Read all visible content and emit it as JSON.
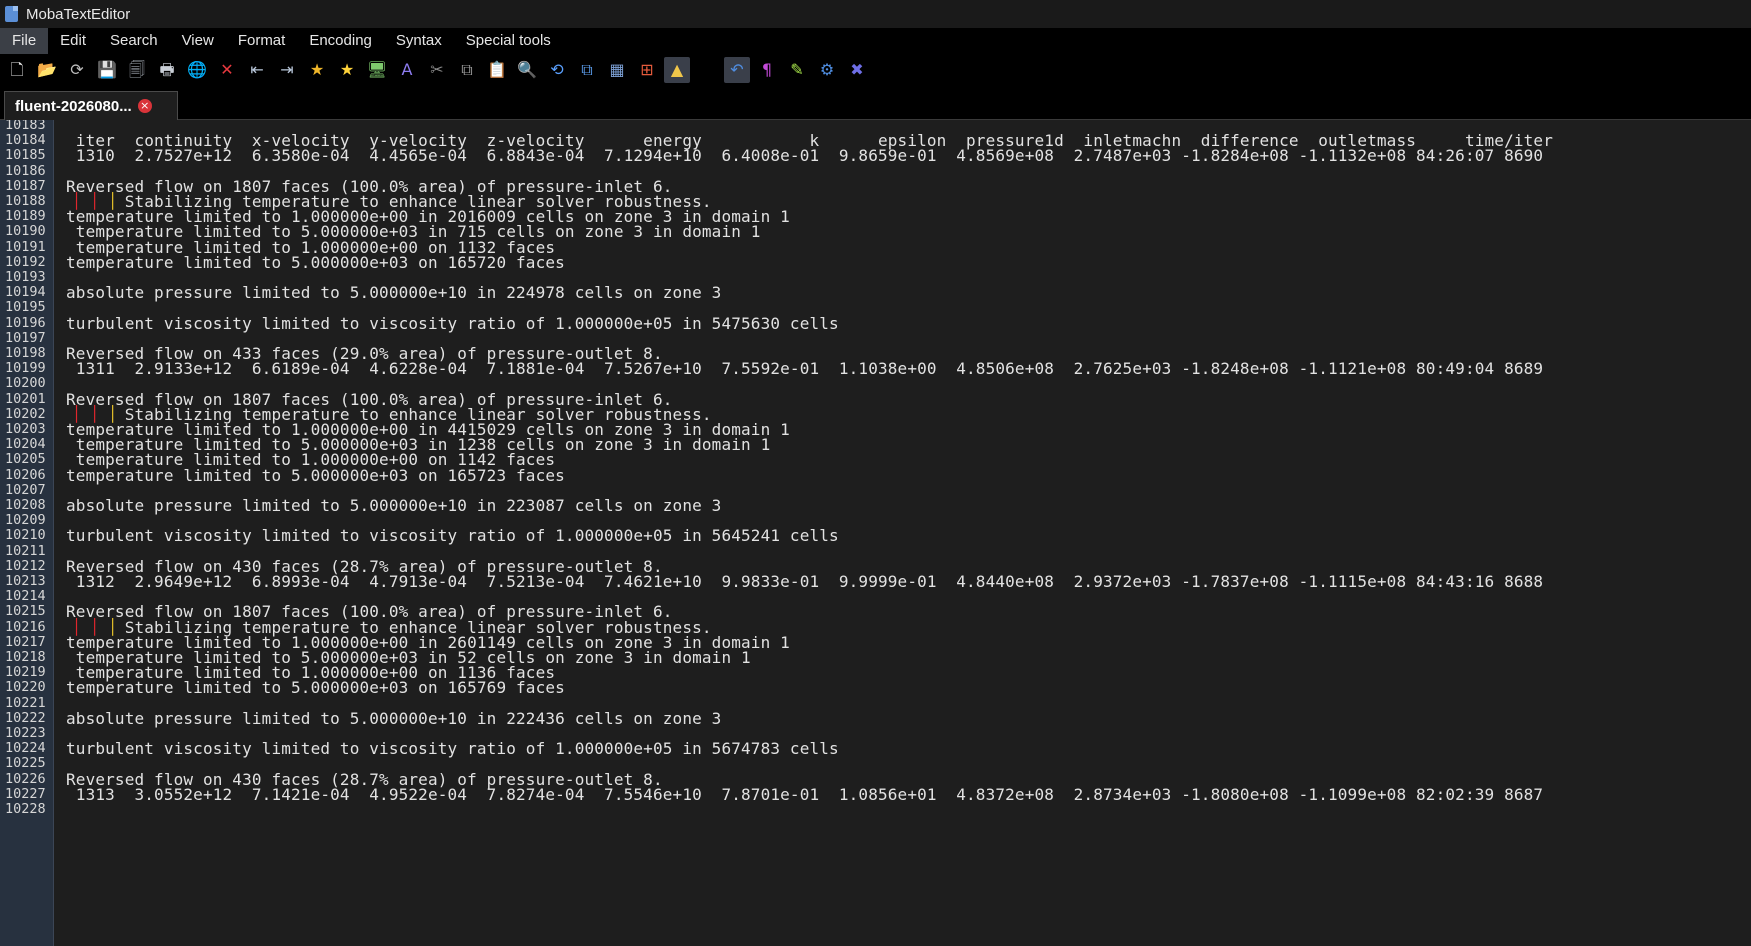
{
  "window": {
    "title": "MobaTextEditor"
  },
  "menu": [
    {
      "label": "File",
      "active": true
    },
    {
      "label": "Edit"
    },
    {
      "label": "Search"
    },
    {
      "label": "View"
    },
    {
      "label": "Format"
    },
    {
      "label": "Encoding"
    },
    {
      "label": "Syntax"
    },
    {
      "label": "Special tools"
    }
  ],
  "toolbar": [
    {
      "name": "new-file-icon",
      "glyph": "🗋",
      "color": "#e8e8e8"
    },
    {
      "name": "open-folder-icon",
      "glyph": "📂",
      "color": "#f1b93d"
    },
    {
      "name": "reload-icon",
      "glyph": "⟳",
      "color": "#bdbdbd"
    },
    {
      "name": "save-icon",
      "glyph": "💾",
      "color": "#9da3ab"
    },
    {
      "name": "save-all-icon",
      "glyph": "🗐",
      "color": "#9da3ab"
    },
    {
      "name": "print-icon",
      "glyph": "🖶",
      "color": "#c9ced6"
    },
    {
      "name": "globe-icon",
      "glyph": "🌐",
      "color": "#4aa3e8"
    },
    {
      "name": "close-icon",
      "glyph": "✕",
      "color": "#e6393f"
    },
    {
      "name": "outdent-icon",
      "glyph": "⇤",
      "color": "#b9c7da"
    },
    {
      "name": "indent-icon",
      "glyph": "⇥",
      "color": "#b9c7da"
    },
    {
      "name": "bookmark-star-icon",
      "glyph": "★",
      "color": "#f0b72a"
    },
    {
      "name": "bookmark-star-2-icon",
      "glyph": "★",
      "color": "#ffd33a"
    },
    {
      "name": "terminal-icon",
      "glyph": "🖥",
      "color": "#7ec86d"
    },
    {
      "name": "font-icon",
      "glyph": "A",
      "color": "#8d7cf0"
    },
    {
      "name": "cut-icon",
      "glyph": "✂",
      "color": "#8a8a8a"
    },
    {
      "name": "copy-icon",
      "glyph": "⧉",
      "color": "#9a9a9a"
    },
    {
      "name": "paste-icon",
      "glyph": "📋",
      "color": "#d8d8d8"
    },
    {
      "name": "search-icon",
      "glyph": "🔍",
      "color": "#5aa0ff"
    },
    {
      "name": "replace-icon",
      "glyph": "⟲",
      "color": "#5aa0ff"
    },
    {
      "name": "compare-icon",
      "glyph": "⧉",
      "color": "#5a9ae8"
    },
    {
      "name": "merge-icon",
      "glyph": "▦",
      "color": "#7b9fd4"
    },
    {
      "name": "windows-icon",
      "glyph": "⊞",
      "color": "#e55b3c"
    },
    {
      "name": "linux-icon",
      "glyph": "▲",
      "color": "#f0c64a",
      "pressed": true
    },
    {
      "name": "apple-icon",
      "glyph": "",
      "color": "#56a8f5"
    },
    {
      "name": "undo-icon",
      "glyph": "↶",
      "color": "#4f8de0",
      "pressed": true
    },
    {
      "name": "pilcrow-icon",
      "glyph": "¶",
      "color": "#c24ad8"
    },
    {
      "name": "highlighter-icon",
      "glyph": "✎",
      "color": "#a6e34a"
    },
    {
      "name": "settings-icon",
      "glyph": "⚙",
      "color": "#4f8de0"
    },
    {
      "name": "exit-icon",
      "glyph": "✖",
      "color": "#6e6ee6"
    }
  ],
  "tab": {
    "label": "fluent-2026080...",
    "close": "×"
  },
  "editor": {
    "lines": [
      {
        "n": "10183",
        "t": ""
      },
      {
        "n": "10184",
        "t": " iter  continuity  x-velocity  y-velocity  z-velocity      energy           k      epsilon  pressure1d  inletmachn  difference  outletmass     time/iter"
      },
      {
        "n": "10185",
        "t": " 1310  2.7527e+12  6.3580e-04  4.4565e-04  6.8843e-04  7.1294e+10  6.4008e-01  9.8659e-01  4.8569e+08  2.7487e+03 -1.8284e+08 -1.1132e+08 84:26:07 8690"
      },
      {
        "n": "10186",
        "t": ""
      },
      {
        "n": "10187",
        "t": "Reversed flow on 1807 faces (100.0% area) of pressure-inlet 6."
      },
      {
        "n": "10188",
        "t": "      Stabilizing temperature to enhance linear solver robustness.",
        "pipes": true
      },
      {
        "n": "10189",
        "t": "temperature limited to 1.000000e+00 in 2016009 cells on zone 3 in domain 1"
      },
      {
        "n": "10190",
        "t": " temperature limited to 5.000000e+03 in 715 cells on zone 3 in domain 1"
      },
      {
        "n": "10191",
        "t": " temperature limited to 1.000000e+00 on 1132 faces"
      },
      {
        "n": "10192",
        "t": "temperature limited to 5.000000e+03 on 165720 faces"
      },
      {
        "n": "10193",
        "t": ""
      },
      {
        "n": "10194",
        "t": "absolute pressure limited to 5.000000e+10 in 224978 cells on zone 3"
      },
      {
        "n": "10195",
        "t": ""
      },
      {
        "n": "10196",
        "t": "turbulent viscosity limited to viscosity ratio of 1.000000e+05 in 5475630 cells"
      },
      {
        "n": "10197",
        "t": ""
      },
      {
        "n": "10198",
        "t": "Reversed flow on 433 faces (29.0% area) of pressure-outlet 8."
      },
      {
        "n": "10199",
        "t": " 1311  2.9133e+12  6.6189e-04  4.6228e-04  7.1881e-04  7.5267e+10  7.5592e-01  1.1038e+00  4.8506e+08  2.7625e+03 -1.8248e+08 -1.1121e+08 80:49:04 8689"
      },
      {
        "n": "10200",
        "t": ""
      },
      {
        "n": "10201",
        "t": "Reversed flow on 1807 faces (100.0% area) of pressure-inlet 6."
      },
      {
        "n": "10202",
        "t": "      Stabilizing temperature to enhance linear solver robustness.",
        "pipes": true
      },
      {
        "n": "10203",
        "t": "temperature limited to 1.000000e+00 in 4415029 cells on zone 3 in domain 1"
      },
      {
        "n": "10204",
        "t": " temperature limited to 5.000000e+03 in 1238 cells on zone 3 in domain 1"
      },
      {
        "n": "10205",
        "t": " temperature limited to 1.000000e+00 on 1142 faces"
      },
      {
        "n": "10206",
        "t": "temperature limited to 5.000000e+03 on 165723 faces"
      },
      {
        "n": "10207",
        "t": ""
      },
      {
        "n": "10208",
        "t": "absolute pressure limited to 5.000000e+10 in 223087 cells on zone 3"
      },
      {
        "n": "10209",
        "t": ""
      },
      {
        "n": "10210",
        "t": "turbulent viscosity limited to viscosity ratio of 1.000000e+05 in 5645241 cells"
      },
      {
        "n": "10211",
        "t": ""
      },
      {
        "n": "10212",
        "t": "Reversed flow on 430 faces (28.7% area) of pressure-outlet 8."
      },
      {
        "n": "10213",
        "t": " 1312  2.9649e+12  6.8993e-04  4.7913e-04  7.5213e-04  7.4621e+10  9.9833e-01  9.9999e-01  4.8440e+08  2.9372e+03 -1.7837e+08 -1.1115e+08 84:43:16 8688"
      },
      {
        "n": "10214",
        "t": ""
      },
      {
        "n": "10215",
        "t": "Reversed flow on 1807 faces (100.0% area) of pressure-inlet 6."
      },
      {
        "n": "10216",
        "t": "      Stabilizing temperature to enhance linear solver robustness.",
        "pipes": true
      },
      {
        "n": "10217",
        "t": "temperature limited to 1.000000e+00 in 2601149 cells on zone 3 in domain 1"
      },
      {
        "n": "10218",
        "t": " temperature limited to 5.000000e+03 in 52 cells on zone 3 in domain 1"
      },
      {
        "n": "10219",
        "t": " temperature limited to 1.000000e+00 on 1136 faces"
      },
      {
        "n": "10220",
        "t": "temperature limited to 5.000000e+03 on 165769 faces"
      },
      {
        "n": "10221",
        "t": ""
      },
      {
        "n": "10222",
        "t": "absolute pressure limited to 5.000000e+10 in 222436 cells on zone 3"
      },
      {
        "n": "10223",
        "t": ""
      },
      {
        "n": "10224",
        "t": "turbulent viscosity limited to viscosity ratio of 1.000000e+05 in 5674783 cells"
      },
      {
        "n": "10225",
        "t": ""
      },
      {
        "n": "10226",
        "t": "Reversed flow on 430 faces (28.7% area) of pressure-outlet 8."
      },
      {
        "n": "10227",
        "t": " 1313  3.0552e+12  7.1421e-04  4.9522e-04  7.8274e-04  7.5546e+10  7.8701e-01  1.0856e+01  4.8372e+08  2.8734e+03 -1.8080e+08 -1.1099e+08 82:02:39 8687"
      },
      {
        "n": "10228",
        "t": ""
      }
    ]
  },
  "colors": {
    "background": "#1e1e1e",
    "gutter": "#27313f",
    "pipe_red": "#e0262d",
    "pipe_yellow": "#e7c32a"
  }
}
